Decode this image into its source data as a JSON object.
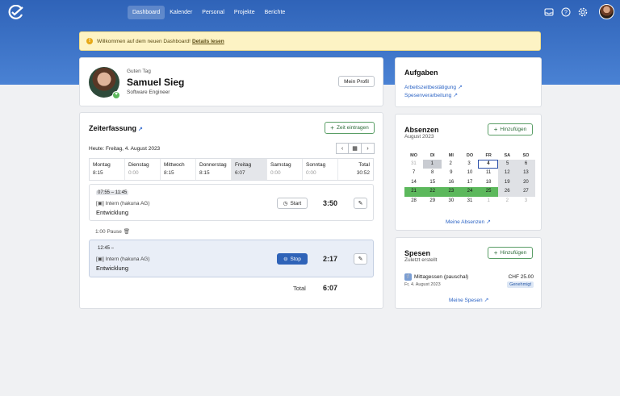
{
  "nav": {
    "links": [
      "Dashboard",
      "Kalender",
      "Personal",
      "Projekte",
      "Berichte"
    ],
    "active": "Dashboard",
    "icons": [
      "inbox-icon",
      "help-icon",
      "gear-icon"
    ]
  },
  "banner": {
    "text": "Willkommen auf dem neuen Dashboard!",
    "link": "Details lesen"
  },
  "profile": {
    "greeting": "Guten Tag",
    "name": "Samuel Sieg",
    "role": "Software Engineer",
    "button": "Mein Profil"
  },
  "zeit": {
    "title": "Zeiterfassung",
    "add_button": "Zeit eintragen",
    "today_label": "Heute: Freitag, 4. August 2023",
    "days": [
      {
        "name": "Montag",
        "value": "8:15"
      },
      {
        "name": "Dienstag",
        "value": "0:00"
      },
      {
        "name": "Mittwoch",
        "value": "8:15"
      },
      {
        "name": "Donnerstag",
        "value": "8:15"
      },
      {
        "name": "Freitag",
        "value": "6:07"
      },
      {
        "name": "Samstag",
        "value": "0:00"
      },
      {
        "name": "Sonntag",
        "value": "0:00"
      },
      {
        "name": "Total",
        "value": "30:52"
      }
    ],
    "entries": [
      {
        "time": "07:55 – 11:45",
        "project": "Intern (hakuna AG)",
        "task": "Entwicklung",
        "action": "Start",
        "duration": "3:50"
      },
      {
        "time": "12:45 –",
        "project": "Intern (hakuna AG)",
        "task": "Entwicklung",
        "action": "Stop",
        "duration": "2:17"
      }
    ],
    "pause": "1:00 Pause",
    "total_label": "Total",
    "total_value": "6:07"
  },
  "aufgaben": {
    "title": "Aufgaben",
    "links": [
      "Arbeitszeitbestätigung",
      "Spesenverarbeitung"
    ]
  },
  "absenzen": {
    "title": "Absenzen",
    "subtitle": "August 2023",
    "add_button": "Hinzufügen",
    "weekdays": [
      "MO",
      "DI",
      "MI",
      "DO",
      "FR",
      "SA",
      "SO"
    ],
    "weeks": [
      [
        "31",
        "1",
        "2",
        "3",
        "4",
        "5",
        "6"
      ],
      [
        "7",
        "8",
        "9",
        "10",
        "11",
        "12",
        "13"
      ],
      [
        "14",
        "15",
        "16",
        "17",
        "18",
        "19",
        "20"
      ],
      [
        "21",
        "22",
        "23",
        "24",
        "25",
        "26",
        "27"
      ],
      [
        "28",
        "29",
        "30",
        "31",
        "1",
        "2",
        "3"
      ]
    ],
    "link": "Meine Absenzen"
  },
  "spesen": {
    "title": "Spesen",
    "subtitle": "Zuletzt erstellt",
    "add_button": "Hinzufügen",
    "item": {
      "name": "Mittagessen (pauschal)",
      "date": "Fr, 4. August 2023",
      "amount": "CHF 25.00",
      "status": "Genehmigt"
    },
    "link": "Meine Spesen"
  },
  "colors": {
    "brand": "#2f63b8",
    "absence": "#5cb85c",
    "stop": "#2f63b8"
  }
}
